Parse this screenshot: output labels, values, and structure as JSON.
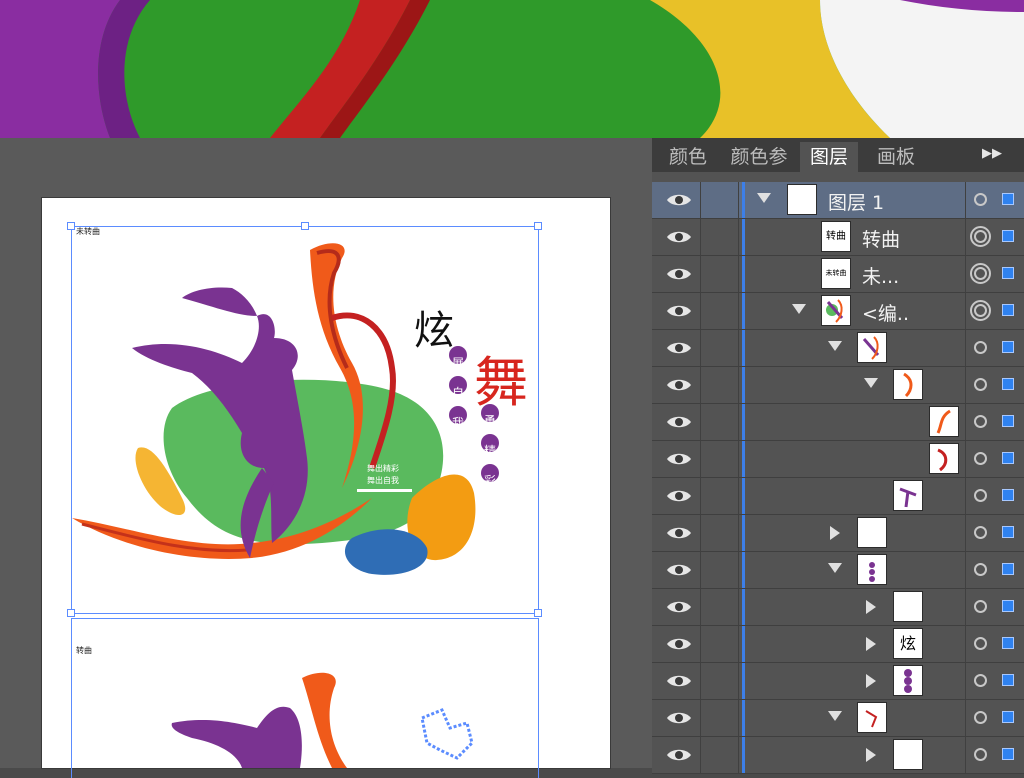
{
  "colors": {
    "banner_purple": "#8a2da1",
    "banner_green": "#2f9a2a",
    "banner_red": "#c42121",
    "banner_yellow": "#e8c128",
    "selection_blue": "#5b8cff",
    "layer_bar_blue": "#3d7fe8"
  },
  "panel": {
    "tabs": [
      {
        "label": "颜色"
      },
      {
        "label": "颜色参"
      },
      {
        "label": "图层"
      },
      {
        "label": "画板"
      }
    ],
    "menu_icon": "double-chevron-right-icon",
    "layers": [
      {
        "name": "图层  1",
        "thumb_label": ""
      },
      {
        "name": "转曲",
        "thumb_label": "转曲"
      },
      {
        "name": "未...",
        "thumb_label": "未转曲"
      },
      {
        "name": "<编..",
        "thumb_label": ""
      },
      {
        "name": "",
        "thumb_label": ""
      },
      {
        "name": "",
        "thumb_label": ""
      },
      {
        "name": "",
        "thumb_label": ""
      },
      {
        "name": "",
        "thumb_label": ""
      },
      {
        "name": "",
        "thumb_label": ""
      },
      {
        "name": "",
        "thumb_label": ""
      },
      {
        "name": "",
        "thumb_label": ""
      },
      {
        "name": "",
        "thumb_label": ""
      },
      {
        "name": "",
        "thumb_label": "炫"
      },
      {
        "name": "",
        "thumb_label": ""
      },
      {
        "name": "",
        "thumb_label": ""
      },
      {
        "name": "",
        "thumb_label": ""
      }
    ]
  },
  "canvas": {
    "artboard_label_top": "未转曲",
    "artboard_label_bottom": "转曲",
    "title_char_1": "炫",
    "title_char_2": "舞",
    "vertical_text_left": "展自我",
    "vertical_text_right": "勇精彩",
    "center_line_1": "舞出精彩",
    "center_line_2": "舞出自我"
  }
}
